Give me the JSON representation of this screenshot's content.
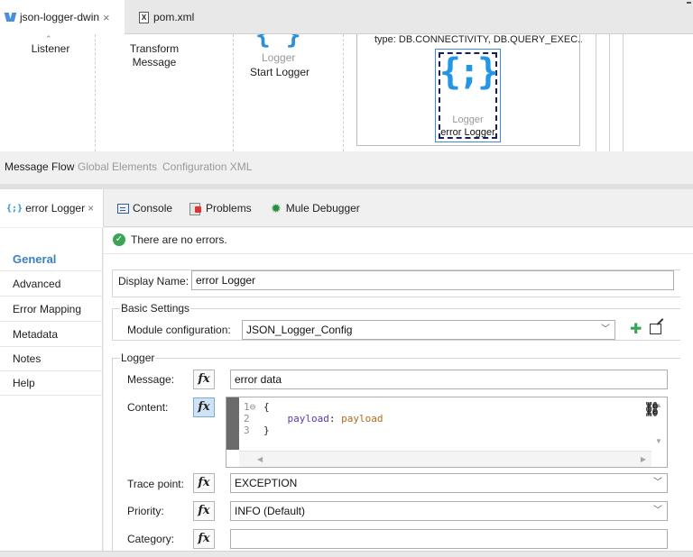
{
  "editor_tabs": [
    {
      "label": "json-logger-dwin",
      "close": "×"
    },
    {
      "label": "pom.xml",
      "icon_glyph": "X"
    }
  ],
  "canvas": {
    "components": [
      {
        "label": "Listener"
      },
      {
        "label_line1": "Transform",
        "label_line2": "Message"
      },
      {
        "sublabel": "Logger",
        "label": "Start Logger"
      }
    ],
    "scope_type": "type: DB.CONNECTIVITY, DB.QUERY_EXEC...",
    "selected": {
      "sublabel": "Logger",
      "label": "error Logger",
      "icon_glyph": "{;}"
    }
  },
  "message_flow_tabs": [
    "Message Flow",
    "Global Elements",
    "Configuration XML"
  ],
  "properties_tabs": {
    "active": {
      "icon_glyph": "{;}",
      "label": "error Logger",
      "close": "×"
    },
    "others": [
      "Console",
      "Problems",
      "Mule Debugger"
    ]
  },
  "side_nav": [
    "General",
    "Advanced",
    "Error Mapping",
    "Metadata",
    "Notes",
    "Help"
  ],
  "status_message": "There are no errors.",
  "form": {
    "display_name_label": "Display Name:",
    "display_name_value": "error Logger",
    "basic_settings_legend": "Basic Settings",
    "module_config_label": "Module configuration:",
    "module_config_value": "JSON_Logger_Config",
    "logger_legend": "Logger",
    "message_label": "Message:",
    "message_value": "error data",
    "content_label": "Content:",
    "content_code": [
      {
        "ln": "1",
        "fold": "⊖",
        "text": "{"
      },
      {
        "ln": "2",
        "key": "payload",
        "sep": ": ",
        "val": "payload"
      },
      {
        "ln": "3",
        "text": "}"
      }
    ],
    "trace_point_label": "Trace point:",
    "trace_point_value": "EXCEPTION",
    "priority_label": "Priority:",
    "priority_value": "INFO (Default)",
    "category_label": "Category:",
    "category_value": "",
    "fx_label": "fx"
  },
  "colors": {
    "accent": "#3b7fc4",
    "logger_blue": "#2496e4",
    "ok_green": "#3aa557"
  }
}
